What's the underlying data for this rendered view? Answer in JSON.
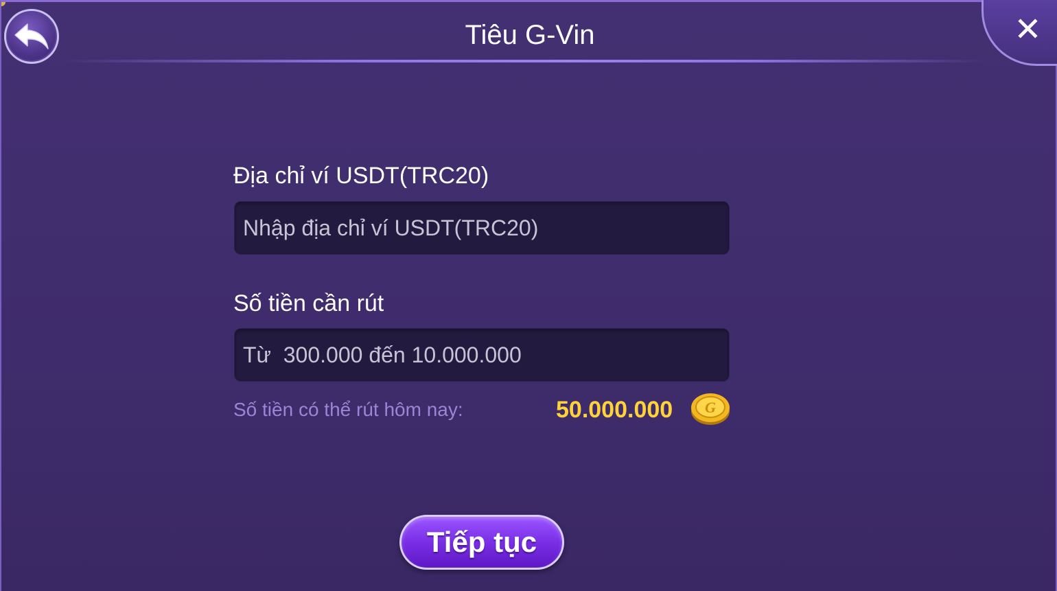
{
  "header": {
    "title": "Tiêu G-Vin",
    "back_icon": "back-arrow-icon",
    "close_icon": "close-icon",
    "close_glyph": "✕"
  },
  "form": {
    "wallet_label": "Địa chỉ ví USDT(TRC20)",
    "wallet_placeholder": "Nhập địa chỉ ví USDT(TRC20)",
    "wallet_value": "",
    "amount_label": "Số tiền cần rút",
    "amount_placeholder": "Từ  300.000 đến 10.000.000",
    "amount_value": "",
    "available_label": "Số tiền có thể rút hôm nay:",
    "available_value": "50.000.000",
    "coin_icon": "gold-coin-icon",
    "coin_letter": "G"
  },
  "actions": {
    "continue_label": "Tiếp tục"
  },
  "colors": {
    "background": "#3f2b6d",
    "accent_gold": "#ffd23a",
    "hint_purple": "#9a86d6",
    "button_purple": "#7a2ee6"
  }
}
